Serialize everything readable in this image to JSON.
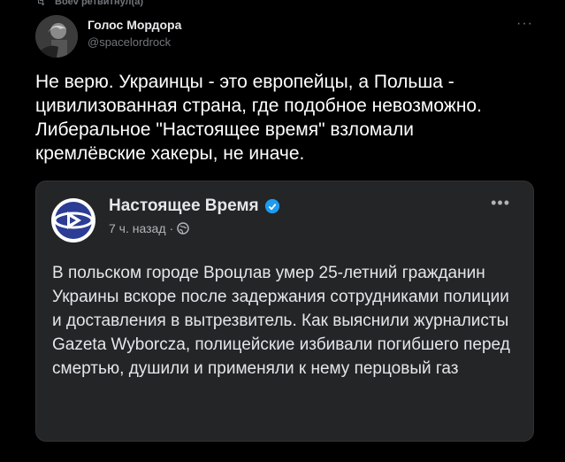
{
  "retweet": {
    "label": "Boev ретвитнул(а)"
  },
  "author": {
    "name": "Голос Мордора",
    "handle": "@spacelordrock"
  },
  "tweet": {
    "text": "Не верю. Украинцы - это европейцы, а Польша -\nцивилизованная страна, где подобное невозможно.\nЛиберальное \"Настоящее время\" взломали\nкремлёвские хакеры, не иначе."
  },
  "embed": {
    "page_name": "Настоящее Время",
    "time": "7 ч. назад",
    "separator": "·",
    "body": "В польском городе Вроцлав умер 25-летний гражданин Украины вскоре после задержания сотрудниками полиции и доставления в вытрезвитель. Как выяснили журналисты Gazeta Wyborcza, полицейские избивали погибшего перед смертью, душили и применяли к нему перцовый газ"
  },
  "colors": {
    "background": "#000000",
    "embed_background": "#242526",
    "accent": "#1d9bf0",
    "logo_blue": "#2b3d94"
  },
  "icons": [
    "retweet-icon",
    "avatar",
    "more-icon",
    "logo-icon",
    "verified-icon",
    "globe-icon"
  ]
}
